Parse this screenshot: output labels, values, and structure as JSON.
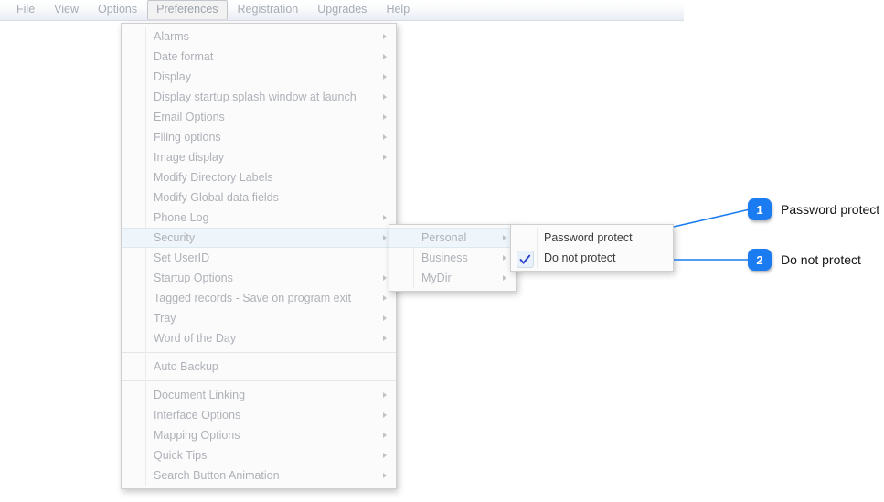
{
  "menubar": {
    "items": [
      {
        "label": "File",
        "active": false
      },
      {
        "label": "View",
        "active": false
      },
      {
        "label": "Options",
        "active": false
      },
      {
        "label": "Preferences",
        "active": true
      },
      {
        "label": "Registration",
        "active": false
      },
      {
        "label": "Upgrades",
        "active": false
      },
      {
        "label": "Help",
        "active": false
      }
    ]
  },
  "preferences_menu": {
    "items": [
      {
        "label": "Alarms",
        "submenu": true
      },
      {
        "label": "Date format",
        "submenu": true
      },
      {
        "label": "Display",
        "submenu": true
      },
      {
        "label": "Display startup splash window at launch",
        "submenu": true
      },
      {
        "label": "Email Options",
        "submenu": true
      },
      {
        "label": "Filing options",
        "submenu": true
      },
      {
        "label": "Image display",
        "submenu": true
      },
      {
        "label": "Modify Directory Labels",
        "submenu": false
      },
      {
        "label": "Modify Global data fields",
        "submenu": false
      },
      {
        "label": "Phone Log",
        "submenu": true
      },
      {
        "label": "Security",
        "submenu": true,
        "highlight": true
      },
      {
        "label": "Set UserID",
        "submenu": false
      },
      {
        "label": "Startup Options",
        "submenu": true
      },
      {
        "label": "Tagged records - Save on program exit",
        "submenu": true
      },
      {
        "label": "Tray",
        "submenu": true
      },
      {
        "label": "Word of the Day",
        "submenu": true
      },
      {
        "separator": true
      },
      {
        "label": "Auto Backup",
        "submenu": false
      },
      {
        "separator": true
      },
      {
        "label": "Document Linking",
        "submenu": true
      },
      {
        "label": "Interface Options",
        "submenu": true
      },
      {
        "label": "Mapping Options",
        "submenu": true
      },
      {
        "label": "Quick Tips",
        "submenu": true
      },
      {
        "label": "Search Button Animation",
        "submenu": true
      }
    ]
  },
  "security_menu": {
    "items": [
      {
        "label": "Personal",
        "submenu": true,
        "highlight": true
      },
      {
        "label": "Business",
        "submenu": true
      },
      {
        "label": "MyDir",
        "submenu": true
      }
    ]
  },
  "personal_menu": {
    "items": [
      {
        "label": "Password protect",
        "checked": false
      },
      {
        "label": "Do not protect",
        "checked": true
      }
    ]
  },
  "callouts": [
    {
      "number": "1",
      "text": "Password protect"
    },
    {
      "number": "2",
      "text": "Do not protect"
    }
  ],
  "colors": {
    "accent": "#1a7cf0",
    "highlight": "#eef6fb",
    "menu_text": "#aeb2b8",
    "enabled_text": "#3a3a3a"
  },
  "icons": {
    "submenu": "chevron-right-icon",
    "check": "check-icon"
  }
}
